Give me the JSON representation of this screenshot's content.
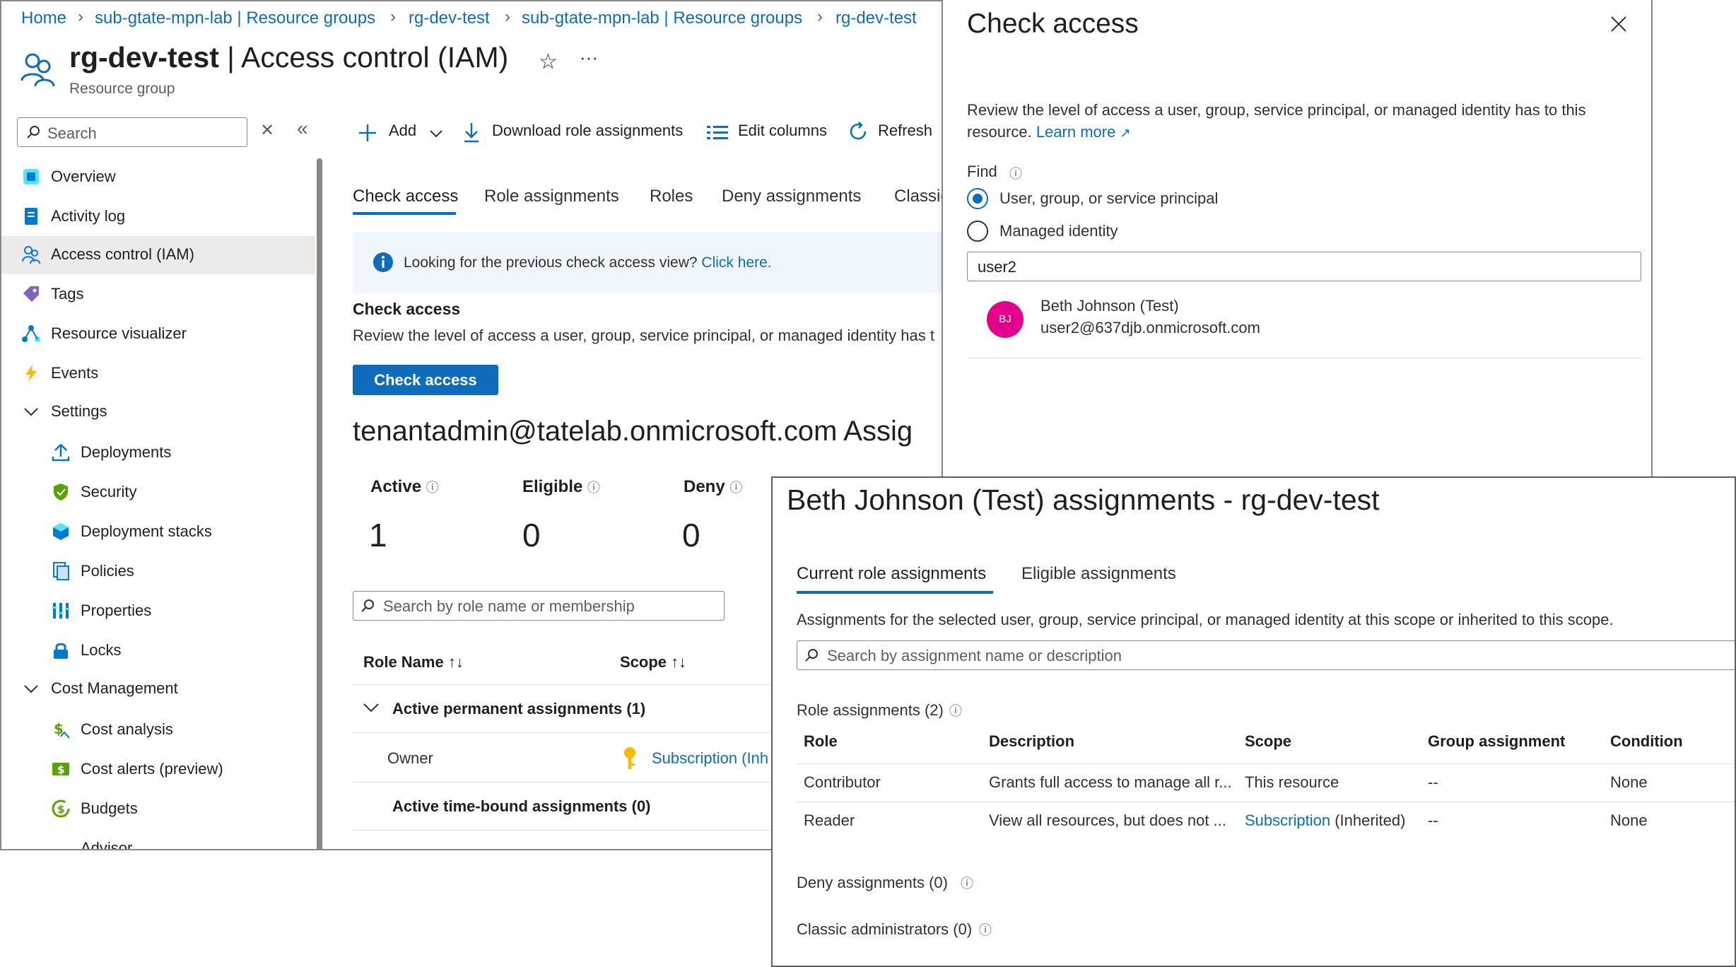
{
  "breadcrumb": [
    "Home",
    "sub-gtate-mpn-lab | Resource groups",
    "rg-dev-test",
    "sub-gtate-mpn-lab | Resource groups",
    "rg-dev-test"
  ],
  "header": {
    "resource_name": "rg-dev-test",
    "page_name": "| Access control (IAM)",
    "subtitle": "Resource group",
    "more": "···"
  },
  "sidebar": {
    "search_placeholder": "Search",
    "items": [
      {
        "label": "Overview",
        "icon": "overview-icon"
      },
      {
        "label": "Activity log",
        "icon": "activity-log-icon"
      },
      {
        "label": "Access control (IAM)",
        "icon": "iam-icon",
        "active": true
      },
      {
        "label": "Tags",
        "icon": "tag-icon"
      },
      {
        "label": "Resource visualizer",
        "icon": "visualizer-icon"
      },
      {
        "label": "Events",
        "icon": "events-icon"
      },
      {
        "label": "Settings",
        "icon": "chevron-down-icon"
      },
      {
        "label": "Deployments",
        "icon": "deployments-icon"
      },
      {
        "label": "Security",
        "icon": "security-icon"
      },
      {
        "label": "Deployment stacks",
        "icon": "deployment-stacks-icon"
      },
      {
        "label": "Policies",
        "icon": "policies-icon"
      },
      {
        "label": "Properties",
        "icon": "properties-icon"
      },
      {
        "label": "Locks",
        "icon": "lock-icon"
      },
      {
        "label": "Cost Management",
        "icon": "chevron-down-icon"
      },
      {
        "label": "Cost analysis",
        "icon": "cost-analysis-icon"
      },
      {
        "label": "Cost alerts (preview)",
        "icon": "cost-alerts-icon"
      },
      {
        "label": "Budgets",
        "icon": "budgets-icon"
      },
      {
        "label": "Advisor",
        "icon": "advisor-icon"
      }
    ]
  },
  "toolbar": {
    "add": "Add",
    "download": "Download role assignments",
    "edit_columns": "Edit columns",
    "refresh": "Refresh"
  },
  "tabs": [
    "Check access",
    "Role assignments",
    "Roles",
    "Deny assignments",
    "Classic"
  ],
  "info_bar": {
    "text": "Looking for the previous check access view?",
    "link": "Click here."
  },
  "check_section": {
    "heading": "Check access",
    "description": "Review the level of access a user, group, service principal, or managed identity has t",
    "button": "Check access"
  },
  "assignments_heading": "tenantadmin@tatelab.onmicrosoft.com Assig",
  "stats": [
    {
      "label": "Active",
      "value": "1"
    },
    {
      "label": "Eligible",
      "value": "0"
    },
    {
      "label": "Deny",
      "value": "0"
    }
  ],
  "table_search_placeholder": "Search by role name or membership",
  "table": {
    "columns": [
      "Role Name",
      "Scope"
    ],
    "group1": "Active permanent assignments (1)",
    "row_role": "Owner",
    "row_scope": "Subscription (Inh",
    "group2": "Active time-bound assignments (0)"
  },
  "check_panel": {
    "title": "Check access",
    "description": "Review the level of access a user, group, service principal, or managed identity has to this resource.",
    "learn_more": "Learn more",
    "find_label": "Find",
    "option1": "User, group, or service principal",
    "option2": "Managed identity",
    "query": "user2",
    "result": {
      "initials": "BJ",
      "name": "Beth Johnson (Test)",
      "email": "user2@637djb.onmicrosoft.com"
    }
  },
  "assign_panel": {
    "title": "Beth Johnson (Test) assignments - rg-dev-test",
    "tabs": [
      "Current role assignments",
      "Eligible assignments"
    ],
    "description": "Assignments for the selected user, group, service principal, or managed identity at this scope or inherited to this scope.",
    "search_placeholder": "Search by assignment name or description",
    "role_assignments_label": "Role assignments (2)",
    "columns": [
      "Role",
      "Description",
      "Scope",
      "Group assignment",
      "Condition"
    ],
    "rows": [
      {
        "role": "Contributor",
        "description": "Grants full access to manage all r...",
        "scope": "This resource",
        "scope_suffix": "",
        "group": "--",
        "condition": "None"
      },
      {
        "role": "Reader",
        "description": "View all resources, but does not ...",
        "scope": "Subscription",
        "scope_suffix": "(Inherited)",
        "group": "--",
        "condition": "None"
      }
    ],
    "deny_label": "Deny assignments (0)",
    "classic_label": "Classic administrators (0)"
  },
  "colors": {
    "accent": "#0f6cbd",
    "avatar": "#e3008c",
    "selected_nav": "#edebe9"
  }
}
